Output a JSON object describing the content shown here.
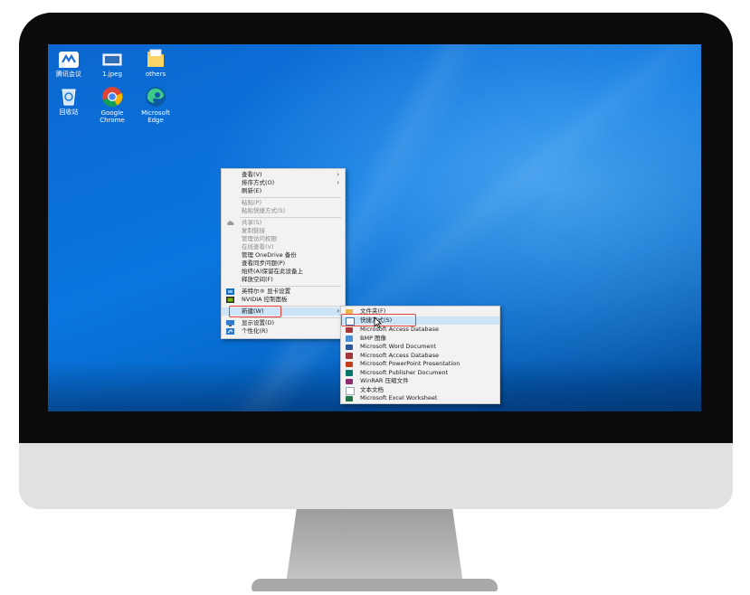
{
  "desktop": {
    "icons": [
      {
        "label": "腾讯会议",
        "icon": "tencent-meeting-icon"
      },
      {
        "label": "1.jpeg",
        "icon": "image-file-icon"
      },
      {
        "label": "others",
        "icon": "folder-icon"
      },
      {
        "label": "回收站",
        "icon": "recycle-bin-icon"
      },
      {
        "label": "Google Chrome",
        "icon": "chrome-icon"
      },
      {
        "label": "Microsoft Edge",
        "icon": "edge-icon"
      }
    ]
  },
  "context_menu": {
    "items": [
      {
        "label": "查看(V)",
        "submenu": true
      },
      {
        "label": "排序方式(O)",
        "submenu": true
      },
      {
        "label": "刷新(E)"
      },
      {
        "label": "粘贴(P)",
        "disabled": true
      },
      {
        "label": "粘贴快捷方式(S)",
        "disabled": true
      },
      {
        "label": "共享(S)",
        "disabled": true,
        "icon": "cloud-icon"
      },
      {
        "label": "复制链接",
        "disabled": true
      },
      {
        "label": "管理访问权限",
        "disabled": true
      },
      {
        "label": "在线查看(V)",
        "disabled": true
      },
      {
        "label": "管理 OneDrive 备份"
      },
      {
        "label": "查看同步问题(P)"
      },
      {
        "label": "始终(A)保留在此设备上"
      },
      {
        "label": "释放空间(F)"
      },
      {
        "label": "英特尔® 显卡设置",
        "icon": "intel-graphics-icon"
      },
      {
        "label": "NVIDIA 控制面板",
        "icon": "nvidia-icon"
      },
      {
        "label": "新建(W)",
        "submenu": true,
        "highlighted": true
      },
      {
        "label": "显示设置(D)",
        "icon": "display-icon"
      },
      {
        "label": "个性化(R)",
        "icon": "personalize-icon"
      }
    ],
    "arrow": "›"
  },
  "submenu_new": {
    "items": [
      {
        "label": "文件夹(F)",
        "icon": "folder-icon",
        "color": "#e8b84a"
      },
      {
        "label": "快捷方式(S)",
        "icon": "shortcut-icon",
        "color": "#3a6fb5",
        "highlighted": true
      },
      {
        "label": "Microsoft Access Database",
        "icon": "access-icon",
        "color": "#a4373a"
      },
      {
        "label": "BMP 图像",
        "icon": "bmp-icon",
        "color": "#4a90d9"
      },
      {
        "label": "Microsoft Word Document",
        "icon": "word-icon",
        "color": "#2b579a"
      },
      {
        "label": "Microsoft Access Database",
        "icon": "access-icon",
        "color": "#a4373a"
      },
      {
        "label": "Microsoft PowerPoint Presentation",
        "icon": "powerpoint-icon",
        "color": "#c43e1c"
      },
      {
        "label": "Microsoft Publisher Document",
        "icon": "publisher-icon",
        "color": "#077568"
      },
      {
        "label": "WinRAR 压缩文件",
        "icon": "winrar-icon",
        "color": "#8a2b6e"
      },
      {
        "label": "文本文档",
        "icon": "text-document-icon",
        "color": "#9aa3ad"
      },
      {
        "label": "Microsoft Excel Worksheet",
        "icon": "excel-icon",
        "color": "#217346"
      }
    ]
  },
  "colors": {
    "highlight": "#cce4f7",
    "annotation_red": "#e8413a",
    "wallpaper": "#0a76df"
  }
}
